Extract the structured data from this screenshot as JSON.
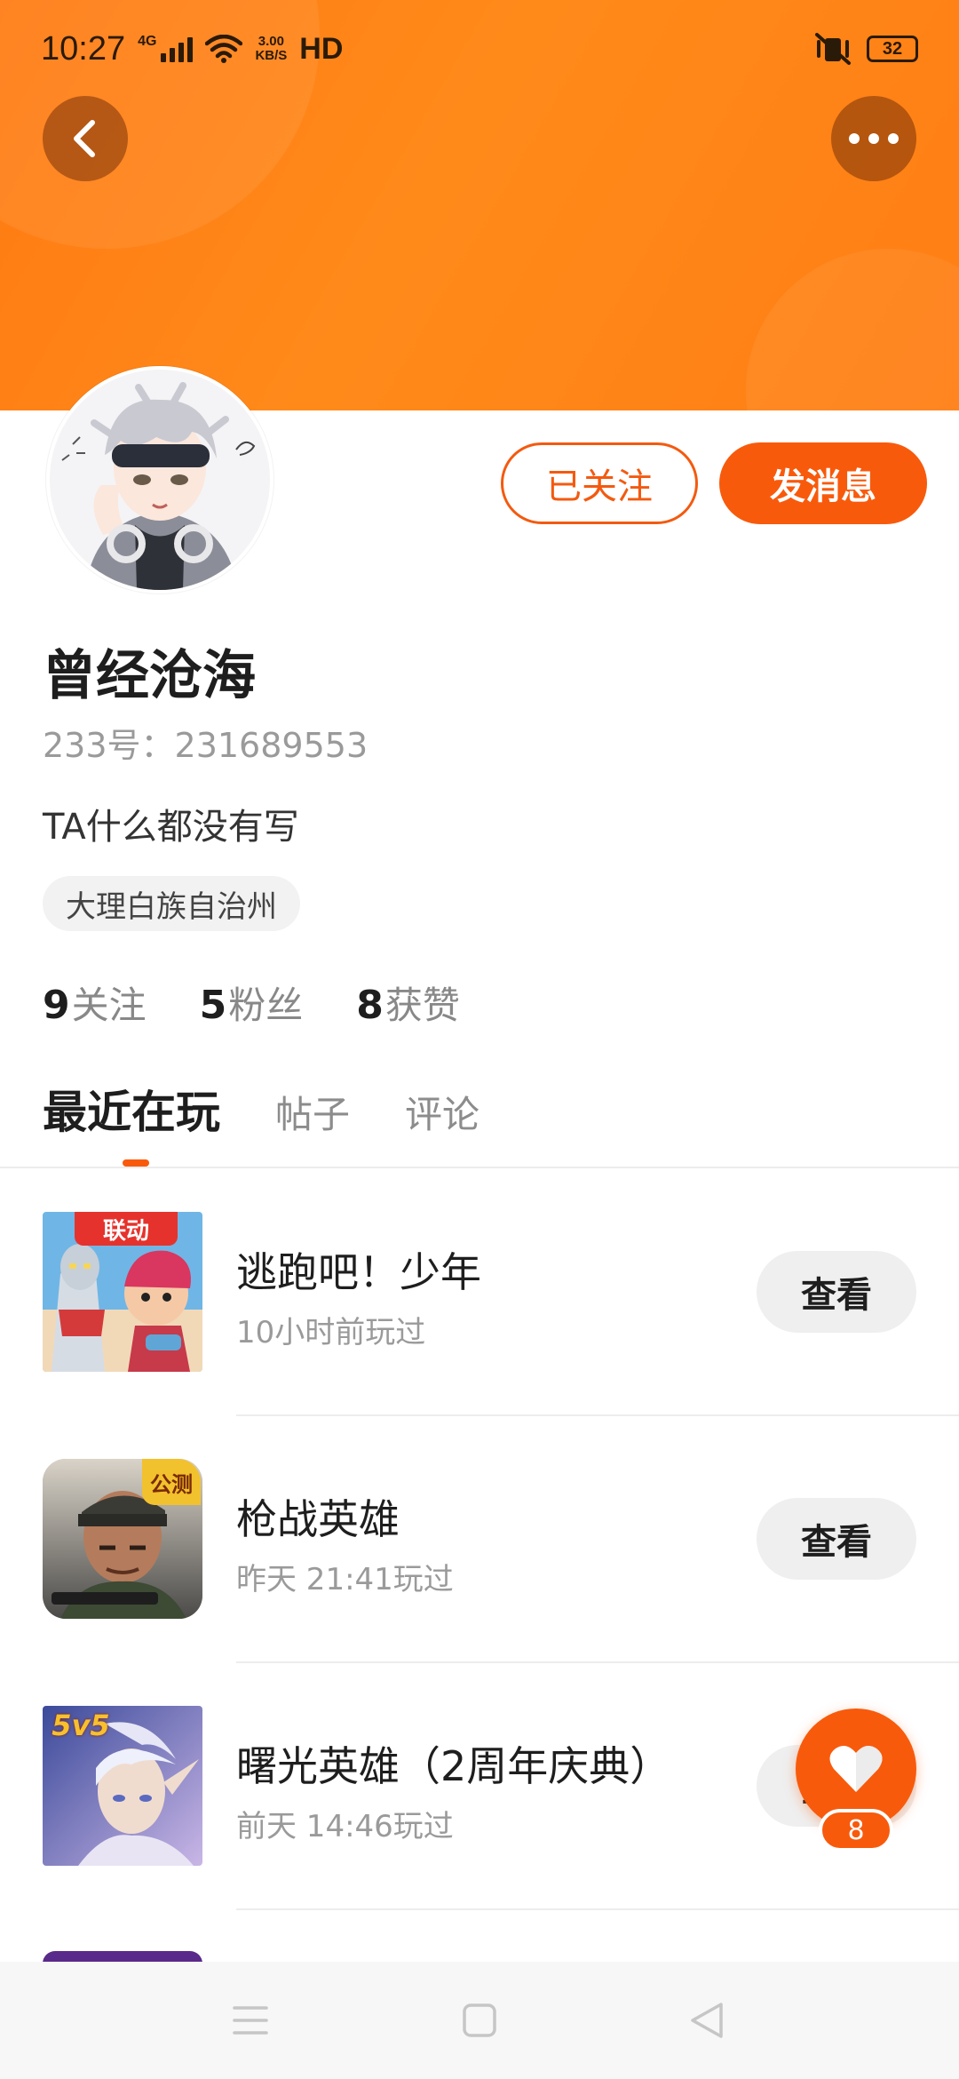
{
  "status_bar": {
    "time": "10:27",
    "network": "4G",
    "speed_top": "3.00",
    "speed_bottom": "KB/S",
    "hd": "HD",
    "battery": "32"
  },
  "profile": {
    "name": "曾经沧海",
    "uid_text": "233号：231689553",
    "bio": "TA什么都没有写",
    "location": "大理白族自治州",
    "follow_label": "已关注",
    "message_label": "发消息"
  },
  "stats": [
    {
      "num": "9",
      "label": "关注"
    },
    {
      "num": "5",
      "label": "粉丝"
    },
    {
      "num": "8",
      "label": "获赞"
    }
  ],
  "tabs": [
    {
      "label": "最近在玩",
      "active": true
    },
    {
      "label": "帖子",
      "active": false
    },
    {
      "label": "评论",
      "active": false
    }
  ],
  "games": [
    {
      "name": "逃跑吧！少年",
      "played": "10小时前玩过",
      "action": "查看",
      "badge": "联动"
    },
    {
      "name": "枪战英雄",
      "played": "昨天 21:41玩过",
      "action": "查看",
      "badge": "公测"
    },
    {
      "name": "曙光英雄（2周年庆典）",
      "played": "前天 14:46玩过",
      "action": "查看",
      "badge": "5v5"
    }
  ],
  "like_fab": {
    "count": "8"
  },
  "colors": {
    "accent": "#f85a0c",
    "banner": "#ff8214"
  }
}
